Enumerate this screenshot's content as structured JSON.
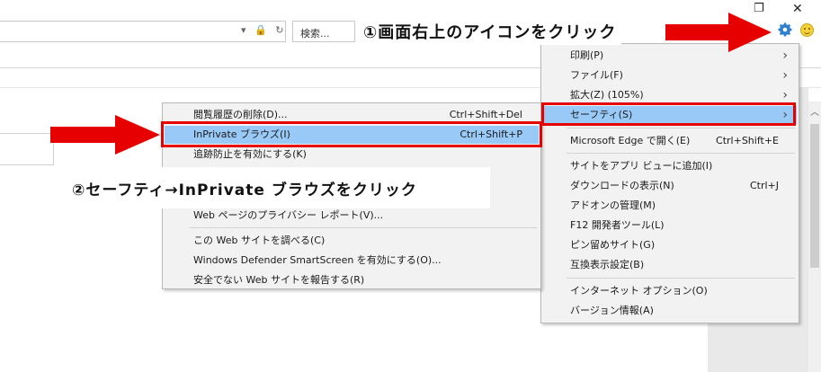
{
  "window": {
    "restore_icon": "restore-icon",
    "close_icon": "close-icon"
  },
  "toolbar": {
    "search_placeholder": "検索...",
    "address_icons": "▾ 🔒 ↻",
    "gear_icon": "gear-icon",
    "smile_icon": "smile-icon"
  },
  "captions": {
    "step1": "①画面右上のアイコンをクリック",
    "step2": "②セーフティ→InPrivate ブラウズをクリック"
  },
  "colors": {
    "highlight": "#99c9f7",
    "annotation_red": "#e60000"
  },
  "main_menu": {
    "items": [
      {
        "label": "印刷(P)",
        "has_arrow": true
      },
      {
        "label": "ファイル(F)",
        "has_arrow": true
      },
      {
        "label": "拡大(Z) (105%)",
        "has_arrow": true
      },
      {
        "label": "セーフティ(S)",
        "has_arrow": true,
        "highlighted": true
      },
      {
        "label": "Microsoft Edge で開く(E)",
        "shortcut": "Ctrl+Shift+E"
      },
      {
        "label": "サイトをアプリ ビューに追加(I)"
      },
      {
        "label": "ダウンロードの表示(N)",
        "shortcut": "Ctrl+J"
      },
      {
        "label": "アドオンの管理(M)"
      },
      {
        "label": "F12 開発者ツール(L)"
      },
      {
        "label": "ピン留めサイト(G)"
      },
      {
        "label": "互換表示設定(B)"
      },
      {
        "label": "インターネット オプション(O)"
      },
      {
        "label": "バージョン情報(A)"
      }
    ]
  },
  "safety_menu": {
    "items": [
      {
        "label": "閲覧履歴の削除(D)...",
        "shortcut": "Ctrl+Shift+Del"
      },
      {
        "label": "InPrivate ブラウズ(I)",
        "shortcut": "Ctrl+Shift+P",
        "highlighted": true
      },
      {
        "label": "追跡防止を有効にする(K)"
      },
      {
        "label": "Web ページのプライバシー レポート(V)..."
      },
      {
        "label": "この Web サイトを調べる(C)"
      },
      {
        "label": "Windows Defender SmartScreen を有効にする(O)..."
      },
      {
        "label": "安全でない Web サイトを報告する(R)"
      }
    ]
  }
}
